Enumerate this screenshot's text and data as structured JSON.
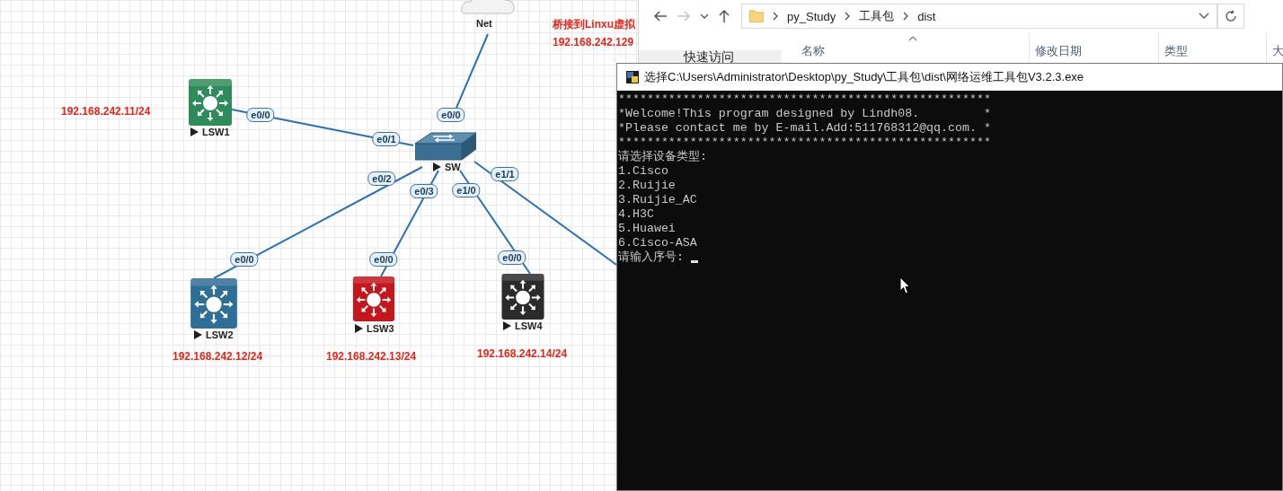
{
  "topology": {
    "note": [
      "桥接到Linxu虚拟",
      "192.168.242.129"
    ],
    "nodes": [
      {
        "label": "Net",
        "kind": "cloud"
      },
      {
        "label": "LSW1",
        "kind": "switch-l3",
        "color": "#2e8b5a",
        "address": "192.168.242.11/24"
      },
      {
        "label": "SW",
        "kind": "switch-l2"
      },
      {
        "label": "LSW2",
        "kind": "switch-l3",
        "color": "#2f6e96",
        "address": "192.168.242.12/24"
      },
      {
        "label": "LSW3",
        "kind": "switch-l3",
        "color": "#c4161c",
        "address": "192.168.242.13/24"
      },
      {
        "label": "LSW4",
        "kind": "switch-l3",
        "color": "#2b2b2b",
        "address": "192.168.242.14/24"
      }
    ],
    "links": [
      {
        "ports": [
          "e0/0"
        ]
      },
      {
        "ports": [
          "e0/0",
          "e0/1"
        ]
      },
      {
        "ports": [
          "e0/2",
          "e0/0"
        ]
      },
      {
        "ports": [
          "e0/3",
          "e0/0"
        ]
      },
      {
        "ports": [
          "e1/0",
          "e0/0"
        ]
      },
      {
        "ports": [
          "e1/1"
        ]
      }
    ]
  },
  "explorer": {
    "path": [
      "py_Study",
      "工具包",
      "dist"
    ],
    "columns": [
      "名称",
      "修改日期",
      "类型",
      "大"
    ],
    "sidebar": [
      "快速访问"
    ]
  },
  "console": {
    "title": "选择C:\\Users\\Administrator\\Desktop\\py_Study\\工具包\\dist\\网络运维工具包V3.2.3.exe",
    "lines": [
      "****************************************************",
      "*Welcome!This program designed by Lindh08.         *",
      "*Please contact me by E-mail.Add:511768312@qq.com. *",
      "****************************************************",
      "请选择设备类型:",
      "1.Cisco",
      "2.Ruijie",
      "3.Ruijie_AC",
      "4.H3C",
      "5.Huawei",
      "6.Cisco-ASA"
    ],
    "prompt": "请输入序号: "
  }
}
